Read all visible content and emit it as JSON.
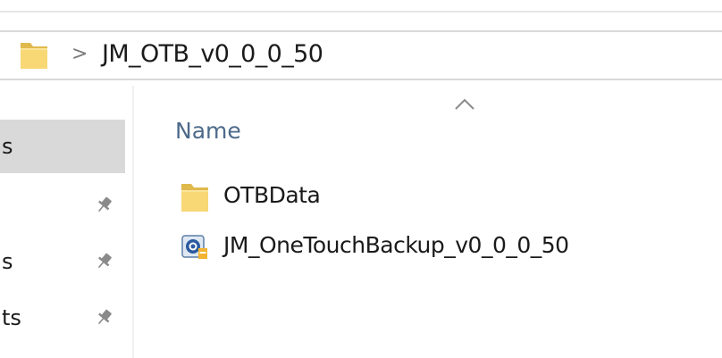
{
  "address_bar": {
    "separator": ">",
    "current_folder": "JM_OTB_v0_0_0_50"
  },
  "nav_pane": {
    "items": [
      {
        "label": "s",
        "pinned": false,
        "selected": true
      },
      {
        "label": "",
        "pinned": true,
        "selected": false
      },
      {
        "label": "s",
        "pinned": true,
        "selected": false
      },
      {
        "label": "ts",
        "pinned": true,
        "selected": false
      }
    ]
  },
  "file_list": {
    "column_header": "Name",
    "sort_direction": "ascending",
    "rows": [
      {
        "name": "OTBData",
        "icon": "folder-icon"
      },
      {
        "name": "JM_OneTouchBackup_v0_0_0_50",
        "icon": "application-icon"
      }
    ]
  },
  "colors": {
    "folder_yellow": "#f8d775",
    "folder_yellow_dark": "#e0b94c",
    "selection_gray": "#d9d9d9",
    "header_text": "#4d6a8a"
  }
}
